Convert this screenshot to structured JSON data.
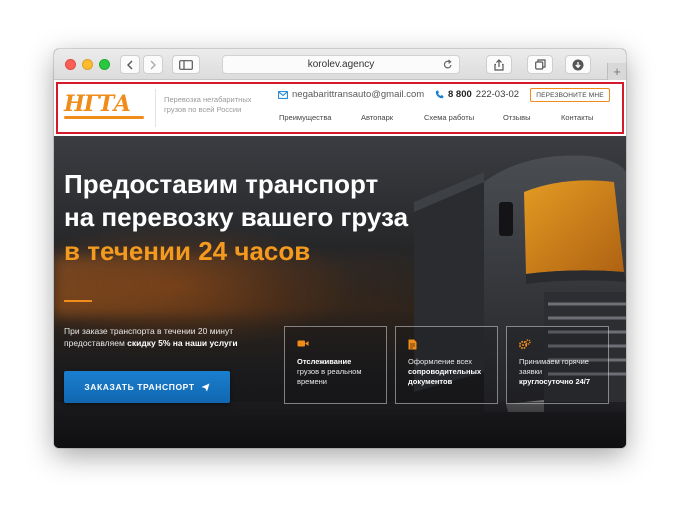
{
  "browser": {
    "url": "korolev.agency",
    "back_icon": "chevron-left-icon",
    "forward_icon": "chevron-right-icon",
    "sidebar_icon": "sidebar-icon",
    "reload_icon": "reload-icon",
    "share_icon": "share-icon",
    "tabs_icon": "tabs-icon",
    "download_icon": "download-icon",
    "new_tab_icon": "plus-icon"
  },
  "header": {
    "logo": "НГТА",
    "tagline": "Перевозка негабаритных грузов по всей России",
    "email": "negabarittransauto@gmail.com",
    "phone_prefix": "8 800",
    "phone_number": "222-03-02",
    "callback_label": "ПЕРЕЗВОНИТЕ МНЕ",
    "nav": [
      "Преимущества",
      "Автопарк",
      "Схема работы",
      "Отзывы",
      "Контакты"
    ]
  },
  "hero": {
    "title_line1": "Предоставим транспорт",
    "title_line2": "на перевозку вашего груза",
    "title_line3": "в течении 24 часов",
    "promo_line1": "При заказе транспорта в течении 20 минут",
    "promo_line2_prefix": "предоставляем",
    "promo_line2_bold": "скидку 5% на наши услуги",
    "order_button": "ЗАКАЗАТЬ ТРАНСПОРТ",
    "features": [
      {
        "icon": "video-camera-icon",
        "bold": "Отслеживание",
        "text": "грузов в реальном времени"
      },
      {
        "icon": "document-icon",
        "text": "Оформление всех",
        "bold": "сопроводительных документов"
      },
      {
        "icon": "gears-icon",
        "text": "Принимаем горячие заявки",
        "bold": "круглосуточно 24/7"
      }
    ]
  },
  "colors": {
    "accent_orange": "#f08c1a",
    "button_blue": "#1167b0",
    "highlight_red": "#d6192b"
  }
}
